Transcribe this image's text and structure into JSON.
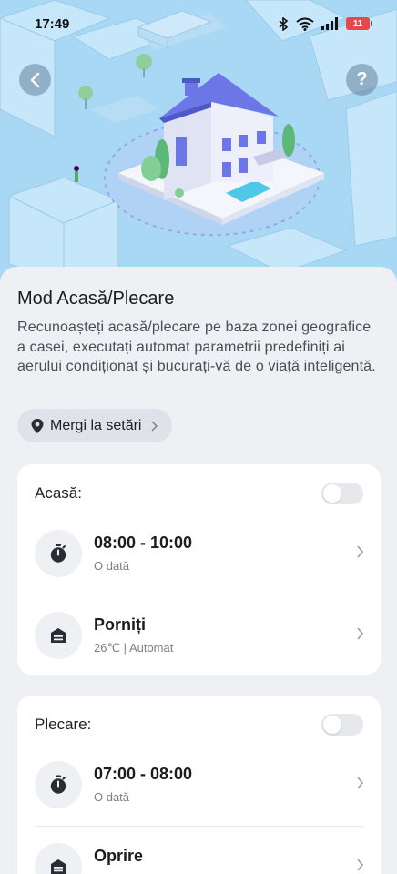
{
  "status_bar": {
    "time": "17:49",
    "battery": "11",
    "icons": [
      "bluetooth-icon",
      "wifi-icon",
      "signal-icon",
      "battery-icon"
    ]
  },
  "header": {
    "back_icon": "chevron-left-icon",
    "help_label": "?"
  },
  "main": {
    "title": "Mod Acasă/Plecare",
    "description": "Recunoașteți acasă/plecare pe baza zonei geografice a casei, executați automat parametrii predefiniți ai aerului condiționat și bucurați-vă de o viață inteligentă.",
    "settings_chip": {
      "icon": "location-pin-icon",
      "label": "Mergi la setări"
    }
  },
  "home_card": {
    "title": "Acasă:",
    "toggle_on": false,
    "schedule": {
      "icon": "timer-icon",
      "time": "08:00 - 10:00",
      "repeat": "O dată"
    },
    "action": {
      "icon": "ac-unit-icon",
      "label": "Porniți",
      "detail": "26℃ | Automat"
    }
  },
  "away_card": {
    "title": "Plecare:",
    "toggle_on": false,
    "schedule": {
      "icon": "timer-icon",
      "time": "07:00 - 08:00",
      "repeat": "O dată"
    },
    "action": {
      "icon": "ac-unit-icon",
      "label": "Oprire"
    }
  },
  "colors": {
    "accent": "#5b63d6",
    "background": "#eef0f3",
    "sky": "#a9d8f5"
  }
}
